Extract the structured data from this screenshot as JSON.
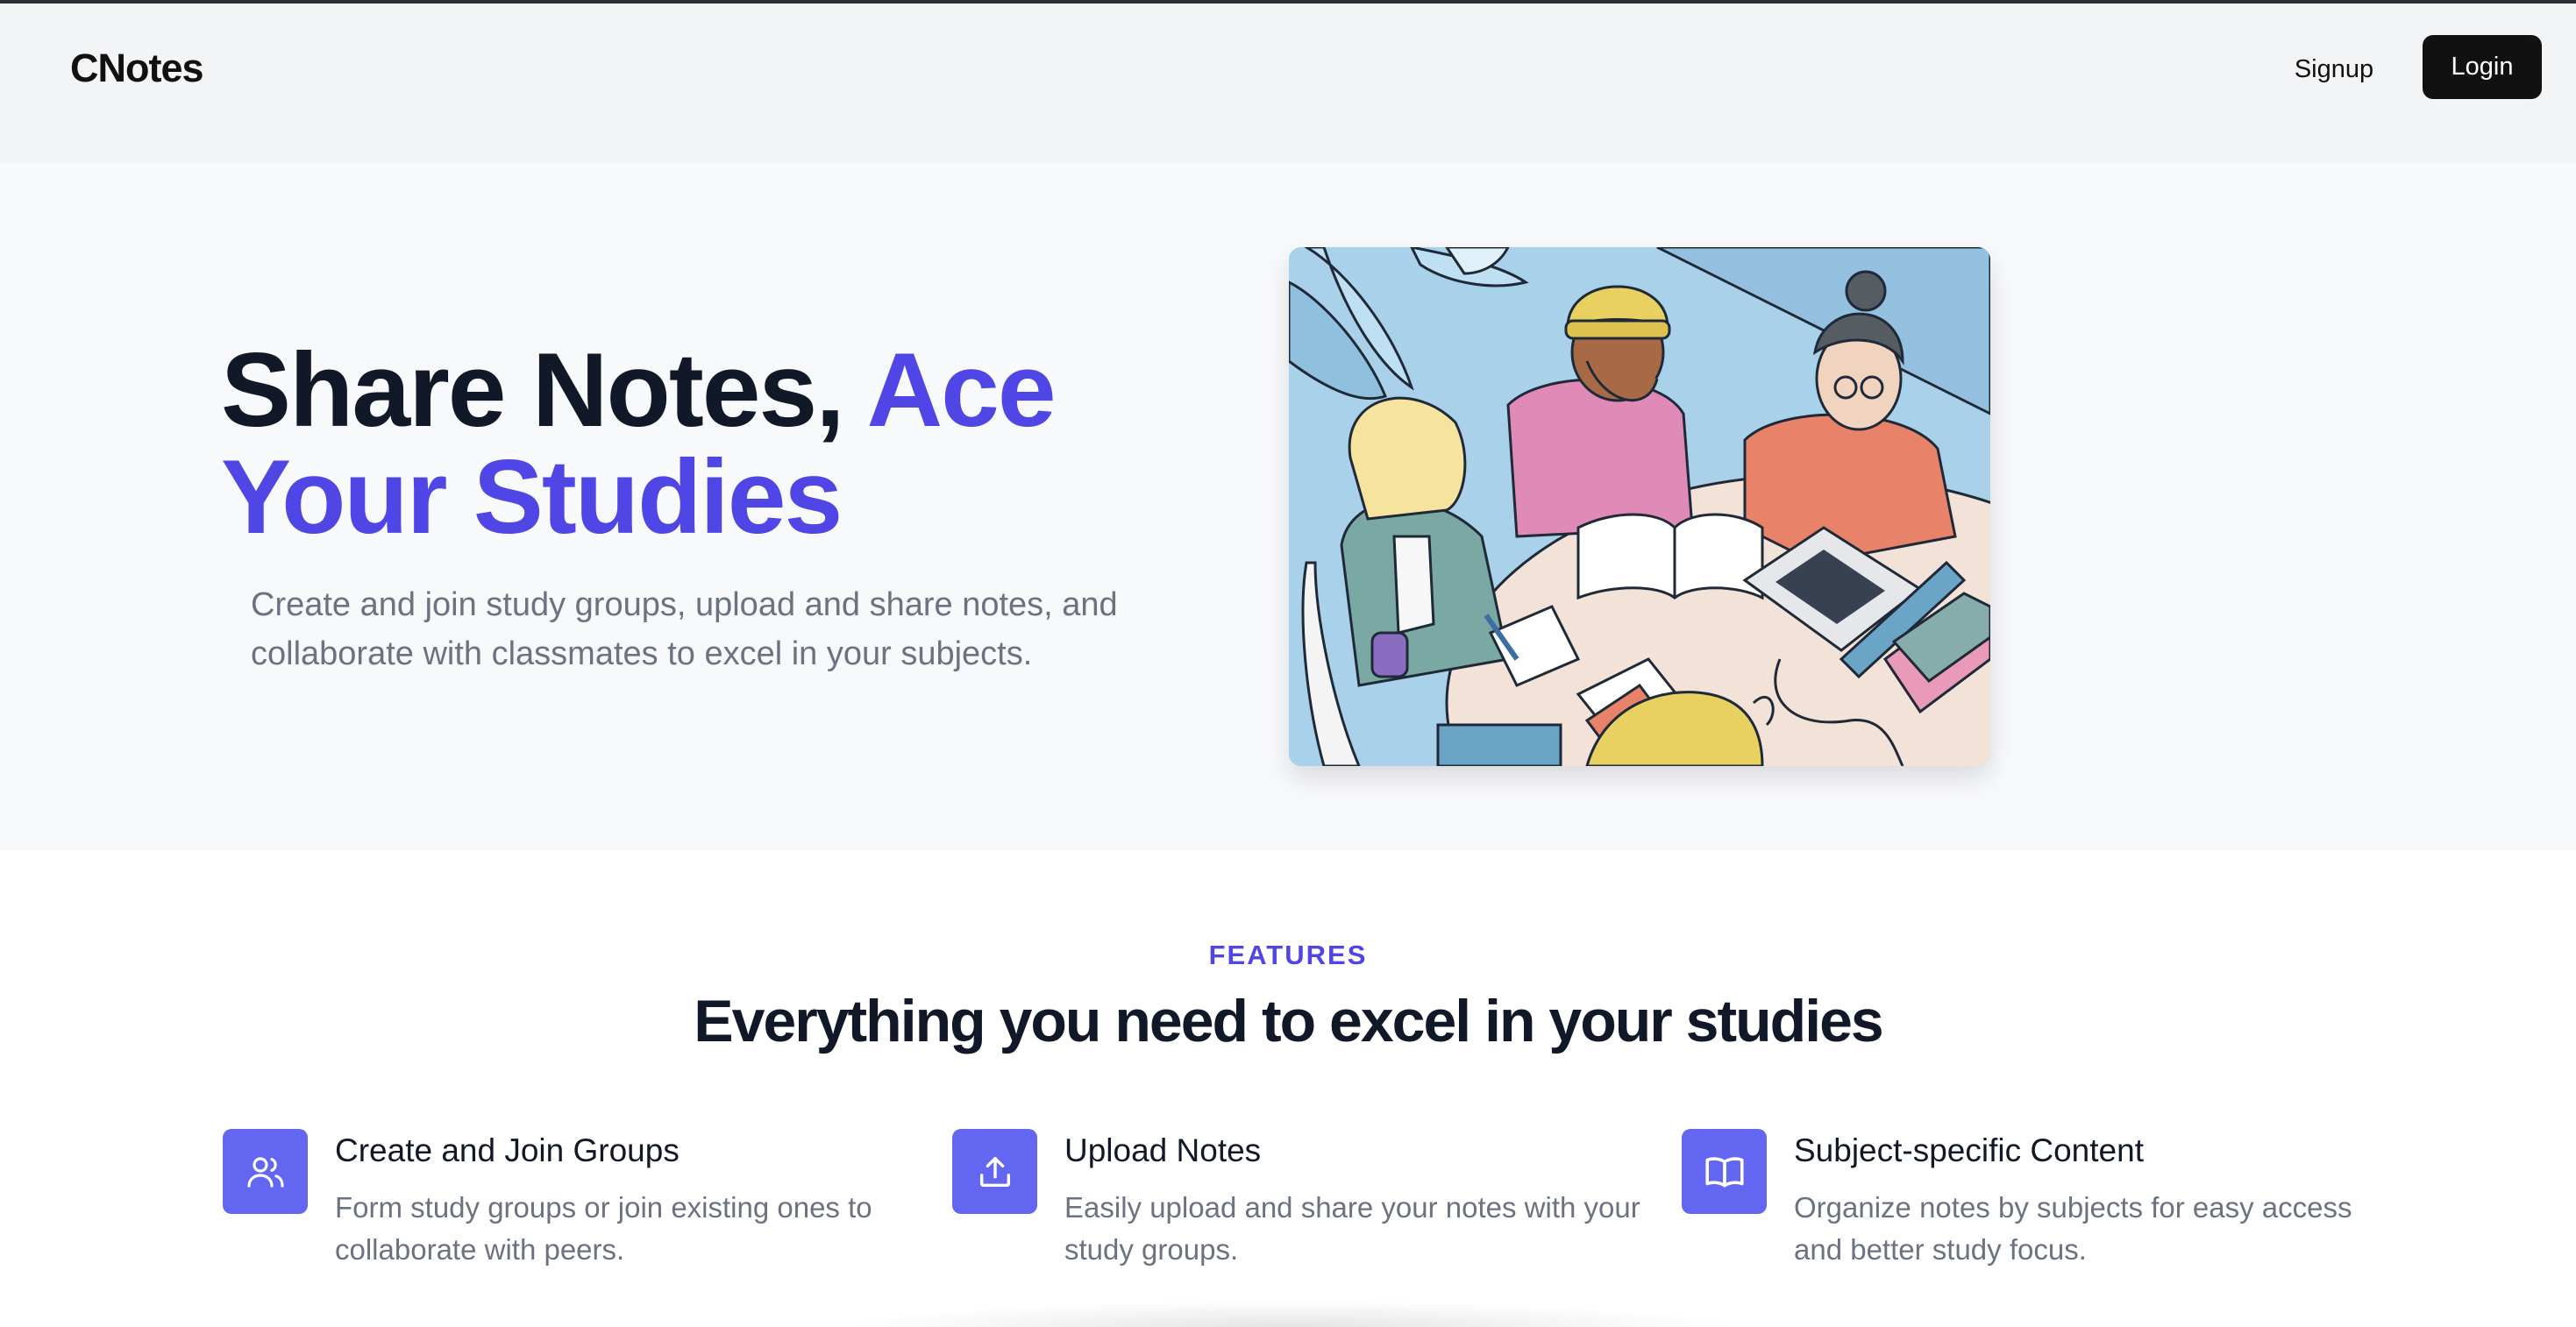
{
  "navbar": {
    "brand": "CNotes",
    "signup_label": "Signup",
    "login_label": "Login"
  },
  "hero": {
    "title_part1": "Share Notes, ",
    "title_accent": "Ace Your Studies",
    "description": "Create and join study groups, upload and share notes, and collaborate with classmates to excel in your subjects.",
    "image_subject": "students-studying-illustration"
  },
  "features": {
    "eyebrow": "FEATURES",
    "title": "Everything you need to excel in your studies",
    "items": [
      {
        "icon": "users-icon",
        "title": "Create and Join Groups",
        "description": "Form study groups or join existing ones to collaborate with peers."
      },
      {
        "icon": "upload-icon",
        "title": "Upload Notes",
        "description": "Easily upload and share your notes with your study groups."
      },
      {
        "icon": "book-icon",
        "title": "Subject-specific Content",
        "description": "Organize notes by subjects for easy access and better study focus."
      }
    ]
  },
  "colors": {
    "accent": "#4f46e5",
    "icon_bg": "#6366f1",
    "nav_bg": "#f3f4f6",
    "hero_bg": "#f8f9fb",
    "login_bg": "#111111"
  }
}
